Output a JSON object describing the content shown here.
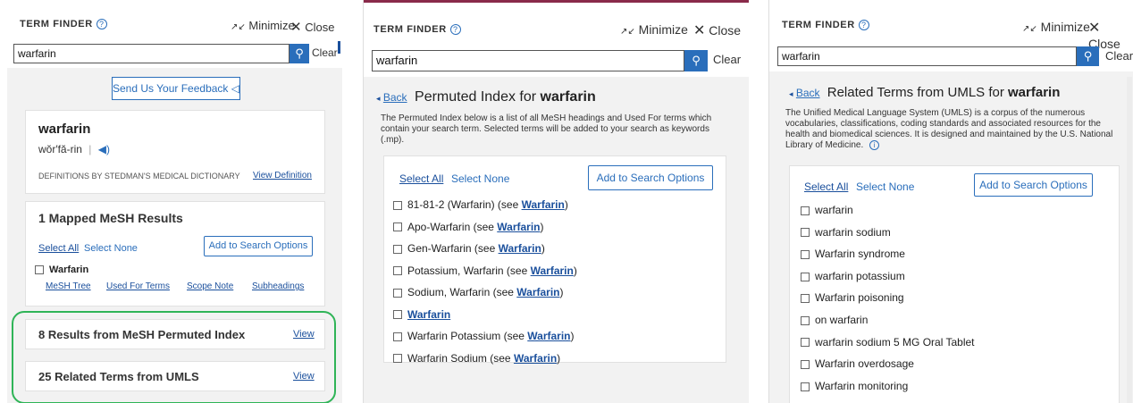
{
  "common": {
    "term_finder": "TERM FINDER",
    "help_glyph": "?",
    "minimize": "Minimize",
    "close": "Close",
    "search_value": "warfarin",
    "clear": "Clear"
  },
  "panel1": {
    "feedback_label": "Send Us Your Feedback",
    "word": "warfarin",
    "pronunciation": "wŏr′fă-rin",
    "definitions_source": "DEFINITIONS BY STEDMAN'S MEDICAL DICTIONARY",
    "view_definition": "View Definition",
    "mesh_title": "1 Mapped MeSH Results",
    "select_all": "Select All",
    "select_none": "Select None",
    "add_to_search": "Add to Search Options",
    "mesh_item": "Warfarin",
    "mesh_links": [
      "MeSH Tree",
      "Used For Terms",
      "Scope Note",
      "Subheadings"
    ],
    "permuted_title": "8 Results from MeSH Permuted Index",
    "umls_title": "25 Related Terms from UMLS",
    "view": "View"
  },
  "panel2": {
    "back": "Back",
    "heading_prefix": "Permuted Index for ",
    "heading_term": "warfarin",
    "description": "The Permuted Index below is a list of all MeSH headings and Used For terms which contain your search term. Selected terms will be added to your search as keywords (.mp).",
    "select_all": "Select All",
    "select_none": "Select None",
    "add_to_search": "Add to Search Options",
    "items": [
      {
        "pre": "81-81-2 (Warfarin) (see ",
        "link": "Warfarin",
        "post": ")"
      },
      {
        "pre": "Apo-Warfarin (see ",
        "link": "Warfarin",
        "post": ")"
      },
      {
        "pre": "Gen-Warfarin (see ",
        "link": "Warfarin",
        "post": ")"
      },
      {
        "pre": "Potassium, Warfarin (see ",
        "link": "Warfarin",
        "post": ")"
      },
      {
        "pre": "Sodium, Warfarin (see ",
        "link": "Warfarin",
        "post": ")"
      },
      {
        "pre": "",
        "link": "Warfarin",
        "post": ""
      },
      {
        "pre": "Warfarin Potassium (see ",
        "link": "Warfarin",
        "post": ")"
      },
      {
        "pre": "Warfarin Sodium (see ",
        "link": "Warfarin",
        "post": ")"
      }
    ]
  },
  "panel3": {
    "back": "Back",
    "heading_prefix": "Related Terms from UMLS for ",
    "heading_term": "warfarin",
    "description": "The Unified Medical Language System (UMLS) is a corpus of the numerous vocabularies, classifications, coding standards and associated resources for the health and biomedical sciences. It is designed and maintained by the U.S. National Library of Medicine.",
    "info_glyph": "i",
    "select_all": "Select All",
    "select_none": "Select None",
    "add_to_search": "Add to Search Options",
    "items": [
      "warfarin",
      "warfarin sodium",
      "Warfarin syndrome",
      "warfarin potassium",
      "Warfarin poisoning",
      "on warfarin",
      "warfarin sodium 5 MG Oral Tablet",
      "Warfarin overdosage",
      "Warfarin monitoring"
    ]
  },
  "colors": {
    "accent": "#2a6ebb",
    "highlight_box": "#2fb457",
    "panel_bg": "#f2f2f2"
  }
}
